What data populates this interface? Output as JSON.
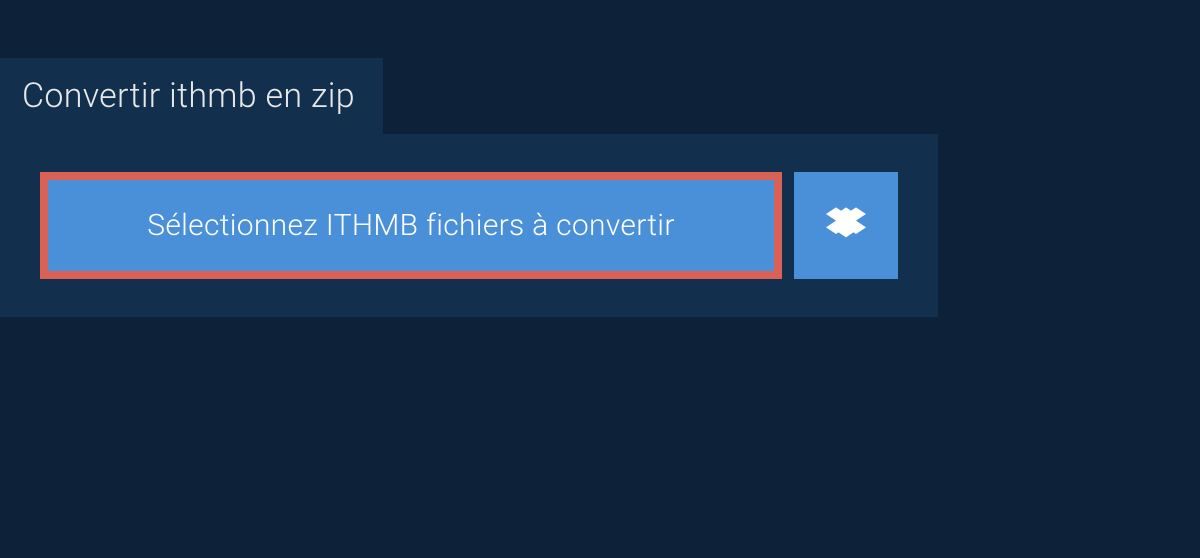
{
  "header": {
    "tab_label": "Convertir ithmb en zip"
  },
  "upload": {
    "select_button_label": "Sélectionnez ITHMB fichiers à convertir",
    "dropbox_icon": "dropbox-icon"
  },
  "colors": {
    "background": "#0d2238",
    "panel": "#12304d",
    "button": "#4a90d9",
    "highlight_border": "#d96156",
    "text": "#e8e8e8"
  }
}
